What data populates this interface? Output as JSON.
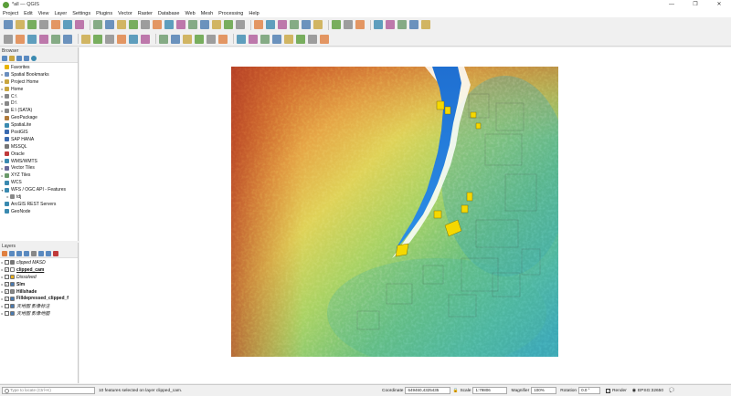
{
  "window": {
    "title": "*all — QGIS",
    "controls": [
      "—",
      "❐",
      "✕"
    ]
  },
  "menu": [
    "Project",
    "Edit",
    "View",
    "Layer",
    "Settings",
    "Plugins",
    "Vector",
    "Raster",
    "Database",
    "Web",
    "Mesh",
    "Processing",
    "Help"
  ],
  "browser": {
    "title": "Browser",
    "items": [
      {
        "label": "Favorites",
        "icon": "star-icon",
        "color": "#e8b400",
        "expand": ""
      },
      {
        "label": "Spatial Bookmarks",
        "icon": "bookmark-icon",
        "color": "#6b8fbf",
        "expand": "▸"
      },
      {
        "label": "Project Home",
        "icon": "folder-icon",
        "color": "#c9a640",
        "expand": "▸"
      },
      {
        "label": "Home",
        "icon": "folder-icon",
        "color": "#c9a640",
        "expand": "▸"
      },
      {
        "label": "C:\\",
        "icon": "drive-icon",
        "color": "#888888",
        "expand": "▸"
      },
      {
        "label": "D:\\",
        "icon": "drive-icon",
        "color": "#888888",
        "expand": "▸"
      },
      {
        "label": "E:\\ (SATA)",
        "icon": "drive-icon",
        "color": "#888888",
        "expand": "▸"
      },
      {
        "label": "GeoPackage",
        "icon": "geopackage-icon",
        "color": "#b07a3a",
        "expand": ""
      },
      {
        "label": "SpatiaLite",
        "icon": "spatialite-icon",
        "color": "#3a8ab0",
        "expand": ""
      },
      {
        "label": "PostGIS",
        "icon": "postgis-icon",
        "color": "#3a6ab0",
        "expand": ""
      },
      {
        "label": "SAP HANA",
        "icon": "database-icon",
        "color": "#3a6ab0",
        "expand": ""
      },
      {
        "label": "MSSQL",
        "icon": "database-icon",
        "color": "#777777",
        "expand": ""
      },
      {
        "label": "Oracle",
        "icon": "database-icon",
        "color": "#c03a3a",
        "expand": ""
      },
      {
        "label": "WMS/WMTS",
        "icon": "globe-icon",
        "color": "#3a8ab0",
        "expand": "▸"
      },
      {
        "label": "Vector Tiles",
        "icon": "grid-icon",
        "color": "#6a6a9a",
        "expand": "▸"
      },
      {
        "label": "XYZ Tiles",
        "icon": "grid-icon",
        "color": "#6a9a6a",
        "expand": "▸"
      },
      {
        "label": "WCS",
        "icon": "globe-icon",
        "color": "#3a8ab0",
        "expand": ""
      },
      {
        "label": "WFS / OGC API - Features",
        "icon": "globe-icon",
        "color": "#3a8ab0",
        "expand": "▾"
      },
      {
        "label": "tdj",
        "icon": "connection-icon",
        "color": "#888888",
        "expand": "▸",
        "indent": true
      },
      {
        "label": "ArcGIS REST Servers",
        "icon": "globe-icon",
        "color": "#3a8ab0",
        "expand": ""
      },
      {
        "label": "GeoNode",
        "icon": "geonode-icon",
        "color": "#3a8ab0",
        "expand": ""
      }
    ]
  },
  "layers": {
    "title": "Layers",
    "items": [
      {
        "label": "clipped MASD",
        "checked": false,
        "italic": true,
        "bold": false,
        "color": "#777777"
      },
      {
        "label": "clipped_cam",
        "checked": true,
        "italic": false,
        "bold": true,
        "underline": true,
        "color": "#ffffff"
      },
      {
        "label": "Dissolved",
        "checked": false,
        "italic": true,
        "bold": false,
        "color": "#e8b020"
      },
      {
        "label": "Slm",
        "checked": true,
        "italic": false,
        "bold": true,
        "color": "#4a7ab0"
      },
      {
        "label": "Hillshade",
        "checked": true,
        "italic": false,
        "bold": true,
        "color": "#888888"
      },
      {
        "label": "Filldepressed_clipped_f",
        "checked": true,
        "italic": false,
        "bold": true,
        "color": "#4a7ab0"
      },
      {
        "label": "天地图 影像标注",
        "checked": false,
        "italic": true,
        "bold": false,
        "color": "#4a7ab0"
      },
      {
        "label": "天地图 影像地图",
        "checked": false,
        "italic": true,
        "bold": false,
        "color": "#4a7ab0"
      }
    ]
  },
  "status": {
    "locator_placeholder": "Type to locate (Ctrl+K)",
    "message": "10 features selected on layer clipped_cam.",
    "coordinate_label": "Coordinate",
    "coordinate": "649460,4325435",
    "scale_label": "Scale",
    "scale": "1:79806",
    "magnifier_label": "Magnifier",
    "magnifier": "100%",
    "rotation_label": "Rotation",
    "rotation": "0.0 °",
    "render_label": "Render",
    "crs": "EPSG:32650"
  },
  "toolbar_icons": [
    "new-project-icon",
    "open-project-icon",
    "save-project-icon",
    "save-as-icon",
    "print-layout-icon",
    "layout-manager-icon",
    "style-manager-icon",
    "pan-icon",
    "pan-to-selection-icon",
    "zoom-in-icon",
    "zoom-out-icon",
    "zoom-full-icon",
    "zoom-to-selection-icon",
    "zoom-to-layer-icon",
    "zoom-native-icon",
    "zoom-last-icon",
    "zoom-next-icon",
    "new-map-view-icon",
    "temporal-icon",
    "refresh-icon",
    "select-icon",
    "deselect-icon",
    "select-by-expression-icon",
    "identify-icon",
    "measure-icon",
    "statistics-icon",
    "attribute-table-icon",
    "field-calculator-icon",
    "toolbox-icon",
    "map-tips-icon",
    "annotation-icon",
    "python-icon",
    "settings-icon",
    "help-icon"
  ]
}
